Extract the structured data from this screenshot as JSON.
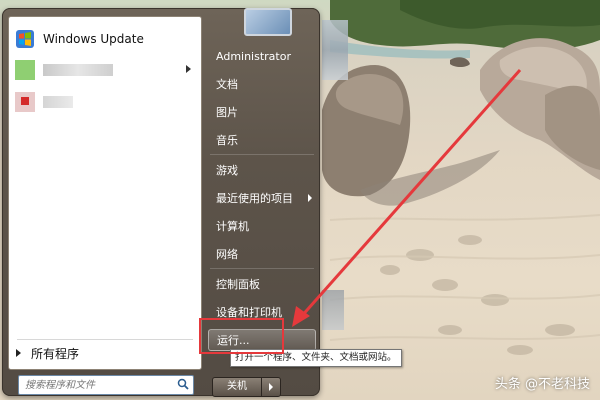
{
  "start_menu": {
    "pinned": [
      {
        "label": "Windows Update",
        "icon": "windows-update-icon"
      }
    ],
    "all_programs_label": "所有程序",
    "search_placeholder": "搜索程序和文件",
    "right_items": [
      {
        "label": "Administrator",
        "submenu": false
      },
      {
        "label": "文档",
        "submenu": false
      },
      {
        "label": "图片",
        "submenu": false
      },
      {
        "label": "音乐",
        "submenu": false
      },
      {
        "label": "游戏",
        "submenu": false
      },
      {
        "label": "最近使用的项目",
        "submenu": true
      },
      {
        "label": "计算机",
        "submenu": false
      },
      {
        "label": "网络",
        "submenu": false
      },
      {
        "label": "控制面板",
        "submenu": false
      },
      {
        "label": "设备和打印机",
        "submenu": false
      },
      {
        "label": "运行...",
        "submenu": false
      }
    ],
    "shutdown_label": "关机",
    "tooltip": "打开一个程序、文件夹、文档或网站。"
  },
  "watermark": "头条 @不老科技",
  "colors": {
    "annotation": "#e5393c",
    "menu_bg": "#5d544a",
    "search_border": "#6c89a7"
  }
}
